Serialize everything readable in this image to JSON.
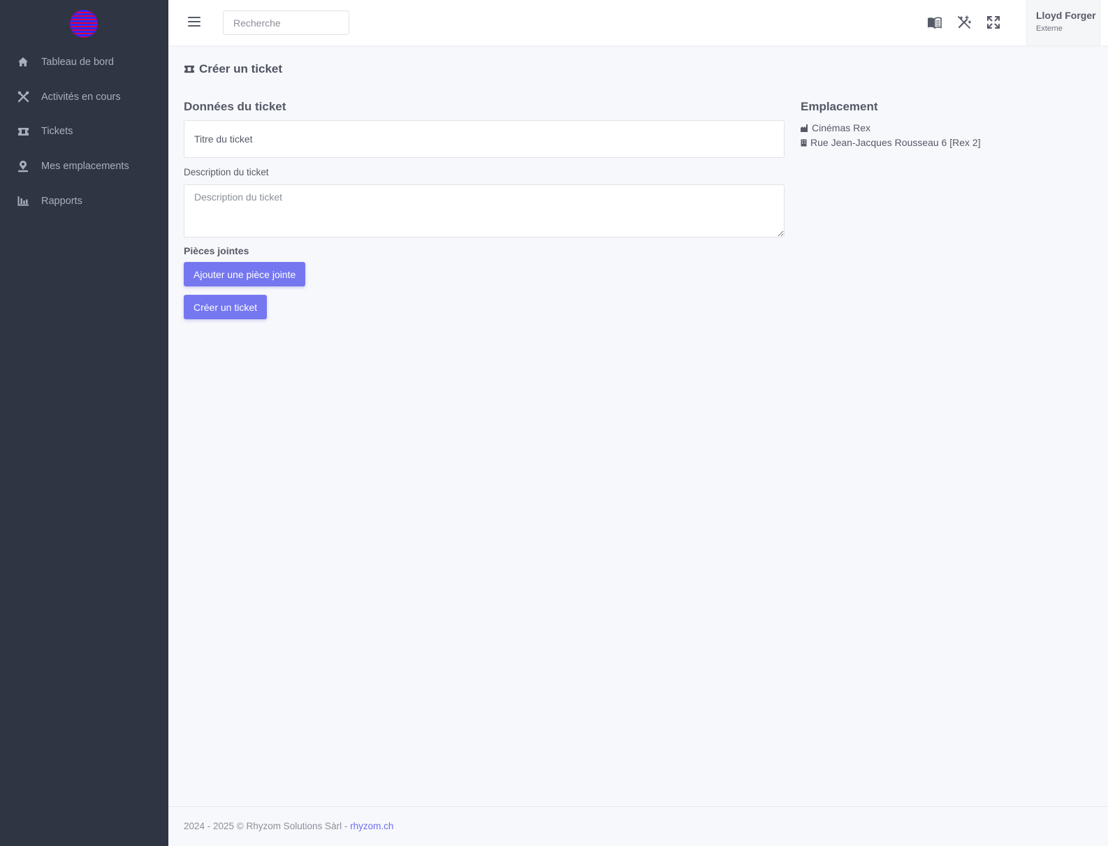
{
  "colors": {
    "sidebar_bg": "#2f3542",
    "accent": "#7577f0",
    "page_bg": "#f7f8fc"
  },
  "sidebar": {
    "logo": "brand-logo",
    "items": [
      {
        "label": "Tableau de bord",
        "icon": "home-icon"
      },
      {
        "label": "Activités en cours",
        "icon": "tools-icon"
      },
      {
        "label": "Tickets",
        "icon": "ticket-icon"
      },
      {
        "label": "Mes emplacements",
        "icon": "map-pin-icon"
      },
      {
        "label": "Rapports",
        "icon": "bar-chart-icon"
      }
    ]
  },
  "topbar": {
    "search_placeholder": "Recherche",
    "icons": [
      "book-icon",
      "magic-off-icon",
      "fullscreen-icon"
    ],
    "user_name": "Lloyd Forger",
    "user_role": "Externe"
  },
  "page": {
    "title": "Créer un ticket",
    "data_section_title": "Données du ticket",
    "ticket_title_placeholder": "Titre du ticket",
    "description_label": "Description du ticket",
    "description_placeholder": "Description du ticket",
    "attachments_label": "Pièces jointes",
    "add_attachment_button": "Ajouter une pièce jointe",
    "create_button": "Créer un ticket"
  },
  "location": {
    "title": "Emplacement",
    "company": "Cinémas Rex",
    "address": "Rue Jean-Jacques Rousseau 6 [Rex 2]"
  },
  "footer": {
    "text": "2024 - 2025 © Rhyzom Solutions Sàrl - ",
    "link": "rhyzom.ch"
  }
}
